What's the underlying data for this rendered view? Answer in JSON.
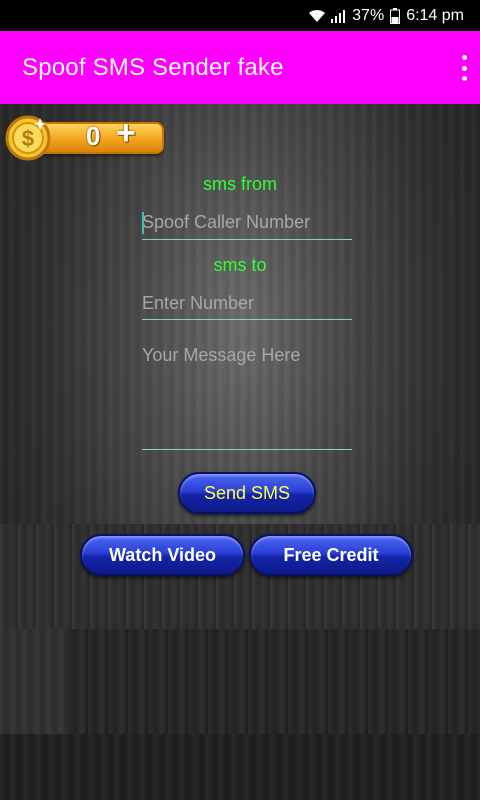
{
  "status_bar": {
    "battery": "37%",
    "time": "6:14 pm",
    "icons": [
      "wifi-icon",
      "signal-icon",
      "battery-icon"
    ]
  },
  "app_bar": {
    "title": "Spoof SMS Sender fake",
    "menu_icon": "overflow-menu-icon",
    "color": "#ff00ff"
  },
  "coins": {
    "count": "0",
    "plus": "+"
  },
  "form": {
    "from_label": "sms from",
    "from_placeholder": "Spoof Caller Number",
    "to_label": "sms to",
    "to_placeholder": "Enter Number",
    "message_placeholder": "Your Message Here"
  },
  "buttons": {
    "send": "Send SMS",
    "watch_video": "Watch Video",
    "free_credit": "Free Credit"
  },
  "colors": {
    "label_green": "#33ff33",
    "send_text": "#ffff55",
    "button_blue": "#2a3fd6"
  }
}
